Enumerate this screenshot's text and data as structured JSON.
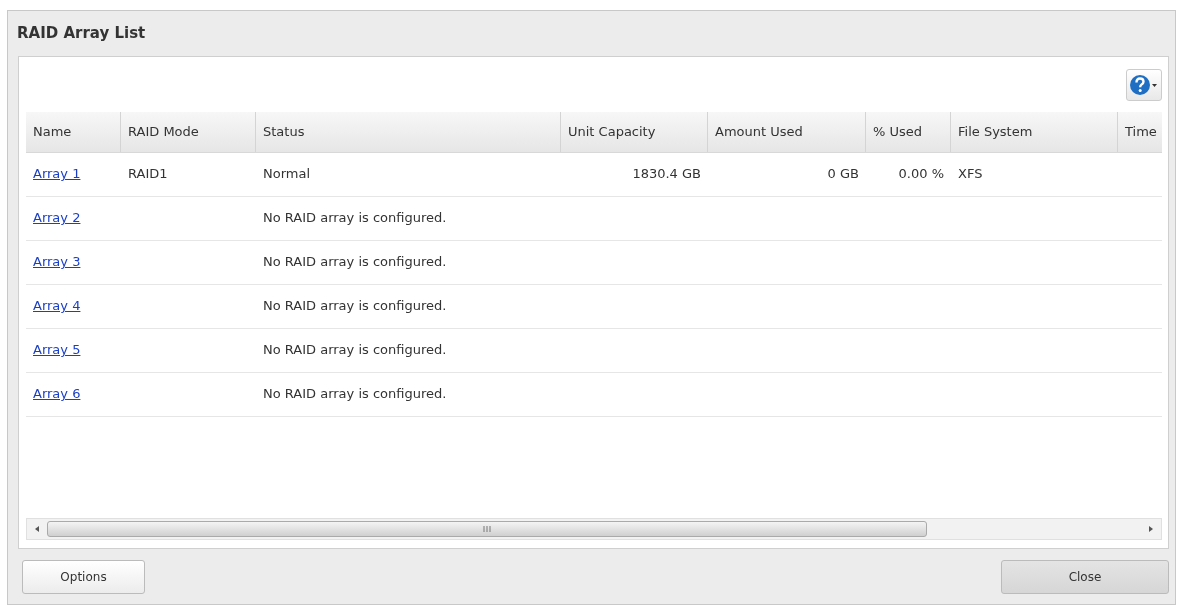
{
  "dialog": {
    "title": "RAID Array List"
  },
  "table": {
    "columns": [
      "Name",
      "RAID Mode",
      "Status",
      "Unit Capacity",
      "Amount Used",
      "% Used",
      "File System",
      "Time"
    ],
    "rows": [
      {
        "name": "Array 1",
        "raid_mode": "RAID1",
        "status": "Normal",
        "unit_capacity": "1830.4 GB",
        "amount_used": "0 GB",
        "percent_used": "0.00 %",
        "file_system": "XFS"
      },
      {
        "name": "Array 2",
        "status": "No RAID array is configured."
      },
      {
        "name": "Array 3",
        "status": "No RAID array is configured."
      },
      {
        "name": "Array 4",
        "status": "No RAID array is configured."
      },
      {
        "name": "Array 5",
        "status": "No RAID array is configured."
      },
      {
        "name": "Array 6",
        "status": "No RAID array is configured."
      }
    ]
  },
  "buttons": {
    "left": "Options",
    "right": "Close"
  }
}
